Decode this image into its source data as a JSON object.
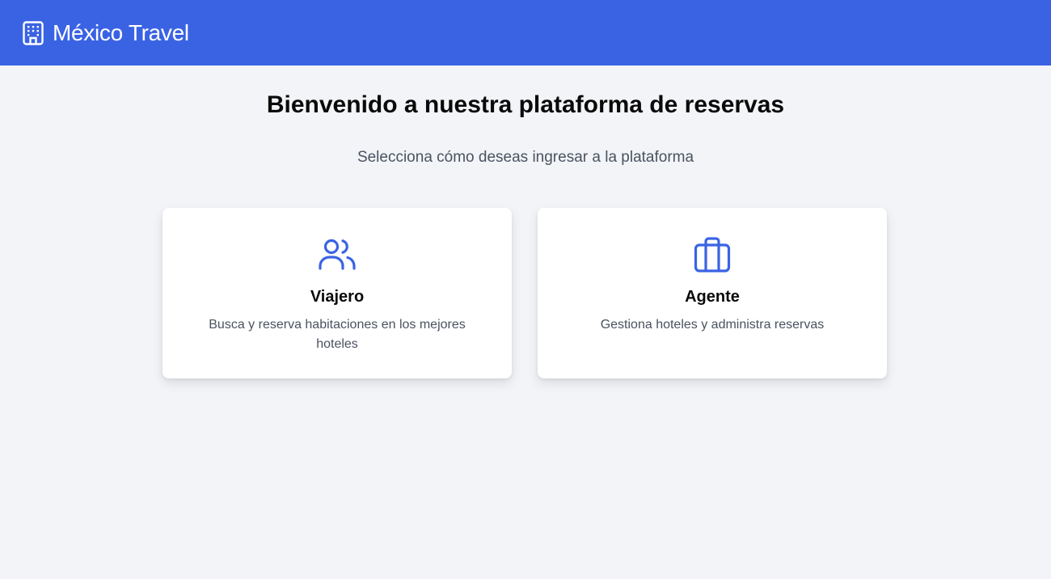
{
  "header": {
    "brand_icon": "hotel-building-icon",
    "brand_name": "México Travel",
    "background_color": "#3a63e4"
  },
  "main": {
    "title": "Bienvenido a nuestra plataforma de reservas",
    "subtitle": "Selecciona cómo deseas ingresar a la plataforma",
    "cards": [
      {
        "icon": "users-icon",
        "title": "Viajero",
        "description": "Busca y reserva habitaciones en los mejores hoteles"
      },
      {
        "icon": "briefcase-icon",
        "title": "Agente",
        "description": "Gestiona hoteles y administra reservas"
      }
    ],
    "accent_color": "#3a63e4"
  }
}
